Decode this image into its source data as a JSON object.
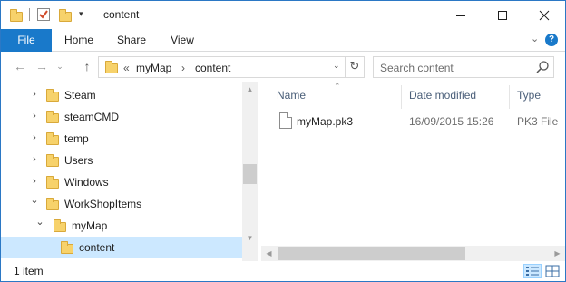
{
  "window": {
    "title": "content"
  },
  "ribbon": {
    "tabs": [
      {
        "label": "File"
      },
      {
        "label": "Home"
      },
      {
        "label": "Share"
      },
      {
        "label": "View"
      }
    ],
    "help_label": "?"
  },
  "address": {
    "prefix": "«",
    "segments": [
      "myMap",
      "content"
    ],
    "separator": "›"
  },
  "search": {
    "placeholder": "Search content"
  },
  "nav_tree": [
    {
      "label": "Steam",
      "chevron": "›",
      "level": 1,
      "selected": false
    },
    {
      "label": "steamCMD",
      "chevron": "›",
      "level": 1,
      "selected": false
    },
    {
      "label": "temp",
      "chevron": "›",
      "level": 1,
      "selected": false
    },
    {
      "label": "Users",
      "chevron": "›",
      "level": 1,
      "selected": false
    },
    {
      "label": "Windows",
      "chevron": "›",
      "level": 1,
      "selected": false
    },
    {
      "label": "WorkShopItems",
      "chevron": "⌄",
      "level": 1,
      "selected": false
    },
    {
      "label": "myMap",
      "chevron": "⌄",
      "level": 2,
      "selected": false
    },
    {
      "label": "content",
      "chevron": "",
      "level": 3,
      "selected": true
    }
  ],
  "columns": [
    {
      "label": "Name"
    },
    {
      "label": "Date modified"
    },
    {
      "label": "Type"
    }
  ],
  "files": [
    {
      "name": "myMap.pk3",
      "date": "16/09/2015 15:26",
      "type": "PK3 File"
    }
  ],
  "status": {
    "count": "1 item"
  },
  "colors": {
    "accent": "#1979ca",
    "selection": "#cce8ff",
    "folder": "#f7d26b",
    "header_text": "#4c607a"
  }
}
